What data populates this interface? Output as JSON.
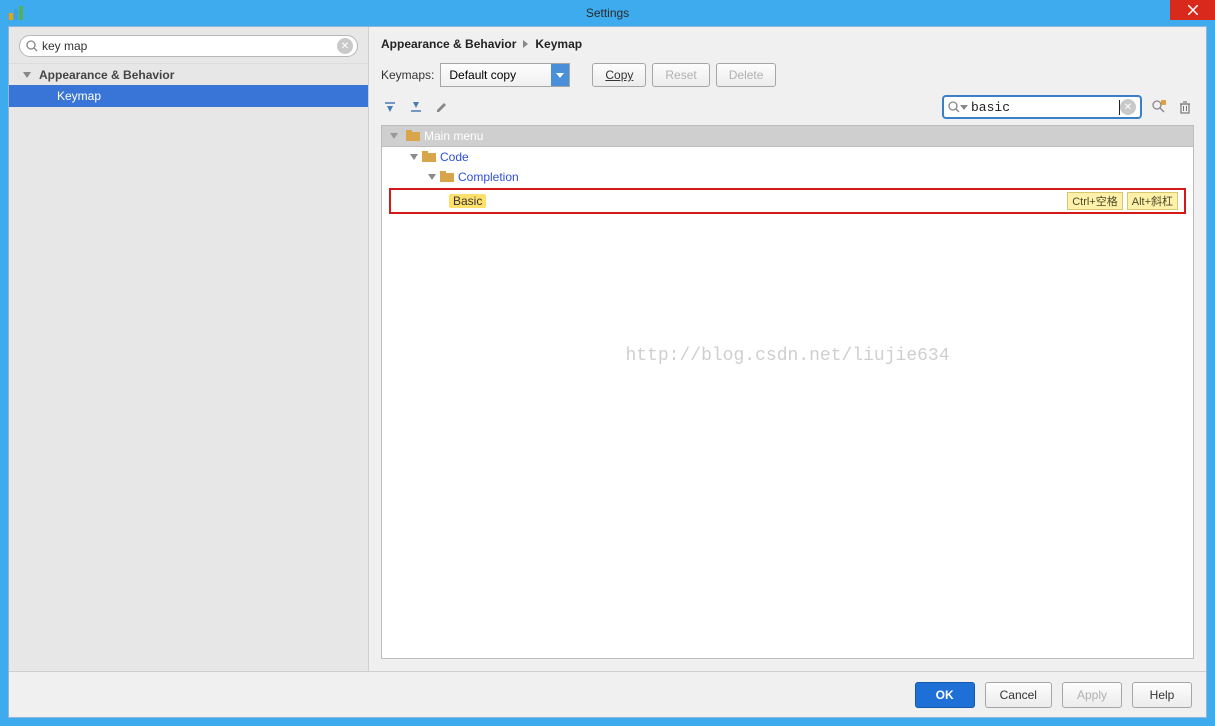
{
  "window": {
    "title": "Settings"
  },
  "sidebar": {
    "search_value": "key map",
    "category": "Appearance & Behavior",
    "selected_item": "Keymap"
  },
  "breadcrumb": {
    "root": "Appearance & Behavior",
    "leaf": "Keymap"
  },
  "keymaps": {
    "label": "Keymaps:",
    "selected": "Default copy",
    "buttons": {
      "copy": "Copy",
      "reset": "Reset",
      "delete": "Delete"
    }
  },
  "action_search": {
    "value": "basic"
  },
  "tree": {
    "root": "Main menu",
    "node_code": "Code",
    "node_completion": "Completion",
    "leaf": {
      "name": "Basic",
      "shortcuts": [
        "Ctrl+空格",
        "Alt+斜杠"
      ]
    }
  },
  "watermark": "http://blog.csdn.net/liujie634",
  "footer": {
    "ok": "OK",
    "cancel": "Cancel",
    "apply": "Apply",
    "help": "Help"
  }
}
